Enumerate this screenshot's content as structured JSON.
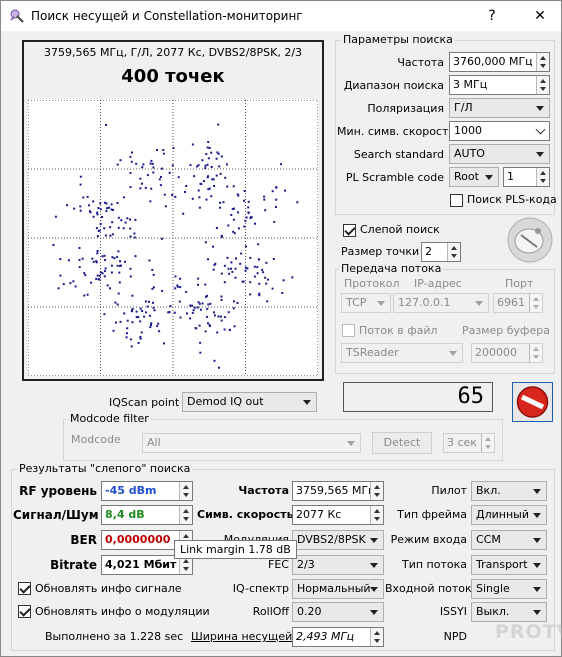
{
  "window": {
    "title": "Поиск несущей и Constellation-мониторинг",
    "help_label": "?",
    "close_label": "✕"
  },
  "constellation": {
    "header": "3759,565 МГц, Г/Л, 2077 Кс, DVBS2/8PSK, 2/3",
    "points_label": "400 точек",
    "dot_color": "#1a1a8c",
    "dot_count": 400
  },
  "search_params": {
    "title": "Параметры поиска",
    "frequency": {
      "label": "Частота",
      "value": "3760,000 МГц"
    },
    "range": {
      "label": "Диапазон поиска",
      "value": "3 МГц"
    },
    "polarization": {
      "label": "Поляризация",
      "value": "Г/Л"
    },
    "min_symbol_rate": {
      "label": "Мин. симв. скорость",
      "value": "1000"
    },
    "search_standard": {
      "label": "Search standard",
      "value": "AUTO"
    },
    "pl_scramble": {
      "label": "PL Scramble code",
      "mode": "Root",
      "value": "1"
    },
    "pls_search": {
      "label": "Поиск PLS-кода",
      "checked": false
    }
  },
  "blind_search": {
    "label": "Слепой поиск",
    "checked": true
  },
  "point_size": {
    "label": "Размер точки",
    "value": "2"
  },
  "stream": {
    "title": "Передача потока",
    "protocol_label": "Протокол",
    "ip_label": "IP-адрес",
    "port_label": "Порт",
    "protocol": "TCP",
    "ip": "127.0.0.1",
    "port": "6961",
    "to_file": {
      "label": "Поток в файл",
      "checked": false
    },
    "buffer_label": "Размер буфера",
    "reader": "TSReader",
    "buffer": "200000"
  },
  "iqscan": {
    "label": "IQScan point",
    "value": "Demod IQ out"
  },
  "counter": {
    "value": "65"
  },
  "modcode_filter": {
    "title": "Modcode filter",
    "label": "Modcode",
    "value": "All",
    "detect_label": "Detect",
    "time": "3 сек"
  },
  "results": {
    "title": "Результаты \"слепого\" поиска",
    "rf_level": {
      "label": "RF уровень",
      "value": "-45 dBm",
      "color": "#1f4fd0"
    },
    "snr": {
      "label": "Сигнал/Шум",
      "value": "8,4 dB",
      "color": "#1e8a1e"
    },
    "ber": {
      "label": "BER",
      "value": "0,0000000",
      "color": "#c00000"
    },
    "bitrate": {
      "label": "Bitrate",
      "value": "4,021 Мбит"
    },
    "frequency": {
      "label": "Частота",
      "value": "3759,565 МГц"
    },
    "symbol_rate": {
      "label": "Симв. скорость",
      "value": "2077 Кс"
    },
    "modulation": {
      "label": "Модуляция",
      "value": "DVBS2/8PSK"
    },
    "fec": {
      "label": "FEC",
      "value": "2/3"
    },
    "iq_spectrum": {
      "label": "IQ-спектр",
      "value": "Нормальный"
    },
    "rolloff": {
      "label": "RollOff",
      "value": "0.20"
    },
    "bandwidth": {
      "label": "Ширина несущей",
      "value": "2,493 МГц"
    },
    "pilot": {
      "label": "Пилот",
      "value": "Вкл."
    },
    "frame_type": {
      "label": "Тип фрейма",
      "value": "Длинный"
    },
    "input_mode": {
      "label": "Режим входа",
      "value": "CCM"
    },
    "stream_type": {
      "label": "Тип потока",
      "value": "Transport"
    },
    "input_stream": {
      "label": "Входной поток",
      "value": "Single"
    },
    "issyi": {
      "label": "ISSYI",
      "value": "Выкл."
    },
    "npd": {
      "label": "NPD"
    }
  },
  "update_signal": {
    "label": "Обновлять инфо сигнале",
    "checked": true
  },
  "update_modulation": {
    "label": "Обновлять инфо о модуляции",
    "checked": true
  },
  "completed": "Выполнено за 1.228 sec",
  "tooltip": "Link margin 1.78 dB",
  "watermark": "PROTV"
}
